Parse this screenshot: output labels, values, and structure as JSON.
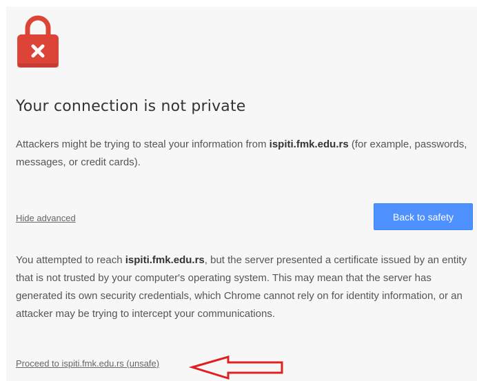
{
  "colors": {
    "lock": "#db4437",
    "lock_shadow": "#b7372b",
    "button": "#4d90fe",
    "arrow": "#e02020",
    "page_background": "#f7f7f7"
  },
  "icons": {
    "lock": "lock-error-icon",
    "annotation": "red-arrow-annotation"
  },
  "title": "Your connection is not private",
  "intro": {
    "before": "Attackers might be trying to steal your information from ",
    "domain": "ispiti.fmk.edu.rs",
    "after": " (for example, passwords, messages, or credit cards)."
  },
  "hide_advanced_label": "Hide advanced",
  "back_button_label": "Back to safety",
  "details": {
    "before": "You attempted to reach ",
    "domain": "ispiti.fmk.edu.rs",
    "after": ", but the server presented a certificate issued by an entity that is not trusted by your computer's operating system. This may mean that the server has generated its own security credentials, which Chrome cannot rely on for identity information, or an attacker may be trying to intercept your communications."
  },
  "proceed_label": "Proceed to ispiti.fmk.edu.rs (unsafe)"
}
